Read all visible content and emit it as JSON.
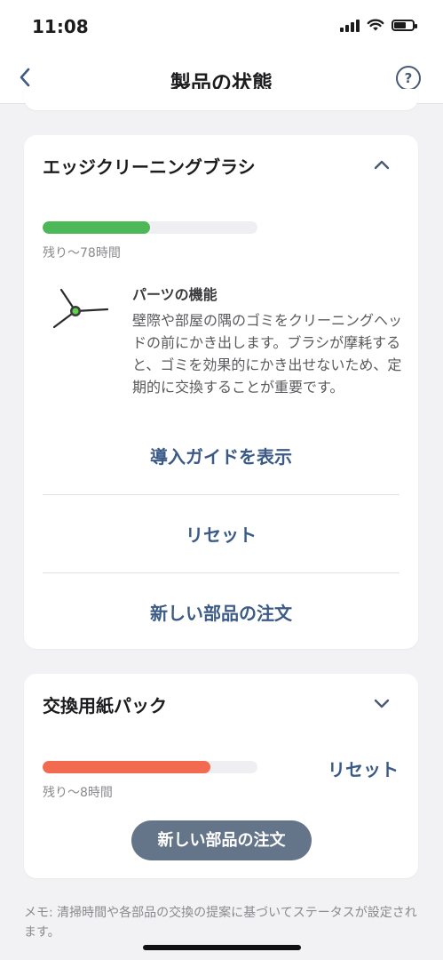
{
  "status": {
    "time": "11:08"
  },
  "nav": {
    "title": "製品の状態",
    "help_glyph": "?"
  },
  "edge_brush": {
    "title": "エッジクリーニングブラシ",
    "remaining_text": "残り〜78時間",
    "remaining_fraction": 0.5,
    "bar_color": "#4cb858",
    "function_title": "パーツの機能",
    "function_desc": "壁際や部屋の隅のゴミをクリーニングヘッドの前にかき出します。ブラシが摩耗すると、ゴミを効果的にかき出せないため、定期的に交換することが重要です。",
    "guide_label": "導入ガイドを表示",
    "reset_label": "リセット",
    "order_label": "新しい部品の注文",
    "expanded": true
  },
  "paper_pack": {
    "title": "交換用紙パック",
    "remaining_text": "残り〜8時間",
    "remaining_fraction": 0.78,
    "bar_color": "#f26b50",
    "reset_label": "リセット",
    "order_label": "新しい部品の注文",
    "expanded": false
  },
  "memo": "メモ: 清掃時間や各部品の交換の提案に基づいてステータスが設定されます。",
  "colors": {
    "accent": "#3b5a86",
    "pill": "#647589",
    "background": "#f2f2f4"
  }
}
